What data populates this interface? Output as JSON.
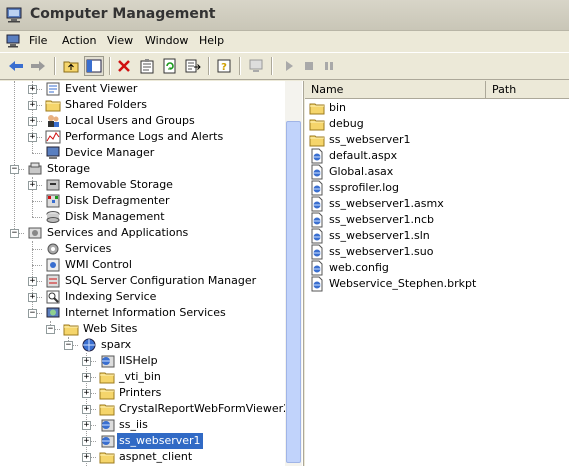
{
  "window": {
    "title": "Computer Management"
  },
  "menu": {
    "items": [
      "File",
      "Action",
      "View",
      "Window",
      "Help"
    ]
  },
  "tree": [
    {
      "label": "Event Viewer",
      "icon": "event-viewer-icon",
      "expander": "+"
    },
    {
      "label": "Shared Folders",
      "icon": "folder-icon",
      "expander": "+"
    },
    {
      "label": "Local Users and Groups",
      "icon": "users-icon",
      "expander": "+"
    },
    {
      "label": "Performance Logs and Alerts",
      "icon": "performance-icon",
      "expander": "+"
    },
    {
      "label": "Device Manager",
      "icon": "device-manager-icon",
      "expander": ""
    },
    {
      "label": "Storage",
      "icon": "storage-icon",
      "expander": "-"
    },
    {
      "label": "Removable Storage",
      "icon": "removable-storage-icon",
      "expander": "+"
    },
    {
      "label": "Disk Defragmenter",
      "icon": "defrag-icon",
      "expander": ""
    },
    {
      "label": "Disk Management",
      "icon": "disk-management-icon",
      "expander": ""
    },
    {
      "label": "Services and Applications",
      "icon": "services-apps-icon",
      "expander": "-"
    },
    {
      "label": "Services",
      "icon": "services-icon",
      "expander": ""
    },
    {
      "label": "WMI Control",
      "icon": "wmi-icon",
      "expander": ""
    },
    {
      "label": "SQL Server Configuration Manager",
      "icon": "sql-icon",
      "expander": "+"
    },
    {
      "label": "Indexing Service",
      "icon": "indexing-icon",
      "expander": "+"
    },
    {
      "label": "Internet Information Services",
      "icon": "iis-icon",
      "expander": "-"
    },
    {
      "label": "Web Sites",
      "icon": "folder-icon",
      "expander": "-"
    },
    {
      "label": "sparx",
      "icon": "website-icon",
      "expander": "-"
    },
    {
      "label": "IISHelp",
      "icon": "web-app-icon",
      "expander": "+"
    },
    {
      "label": "_vti_bin",
      "icon": "folder-icon",
      "expander": "+"
    },
    {
      "label": "Printers",
      "icon": "folder-icon",
      "expander": "+"
    },
    {
      "label": "CrystalReportWebFormViewer2",
      "icon": "folder-icon",
      "expander": "+"
    },
    {
      "label": "ss_iis",
      "icon": "web-app-icon",
      "expander": "+"
    },
    {
      "label": "ss_webserver1",
      "icon": "web-app-icon",
      "expander": "+",
      "selected": true
    },
    {
      "label": "aspnet_client",
      "icon": "folder-icon",
      "expander": "+"
    }
  ],
  "list": {
    "columns": [
      "Name",
      "Path"
    ],
    "items": [
      {
        "name": "bin",
        "type": "folder"
      },
      {
        "name": "debug",
        "type": "folder"
      },
      {
        "name": "ss_webserver1",
        "type": "folder"
      },
      {
        "name": "default.aspx",
        "type": "file"
      },
      {
        "name": "Global.asax",
        "type": "file"
      },
      {
        "name": "ssprofiler.log",
        "type": "file"
      },
      {
        "name": "ss_webserver1.asmx",
        "type": "file"
      },
      {
        "name": "ss_webserver1.ncb",
        "type": "file"
      },
      {
        "name": "ss_webserver1.sln",
        "type": "file"
      },
      {
        "name": "ss_webserver1.suo",
        "type": "file"
      },
      {
        "name": "web.config",
        "type": "file"
      },
      {
        "name": "Webservice_Stephen.brkpt",
        "type": "file"
      }
    ]
  },
  "colors": {
    "selection": "#316AC5",
    "folder": "#F5D56B",
    "chrome": "#ECE9D8"
  }
}
